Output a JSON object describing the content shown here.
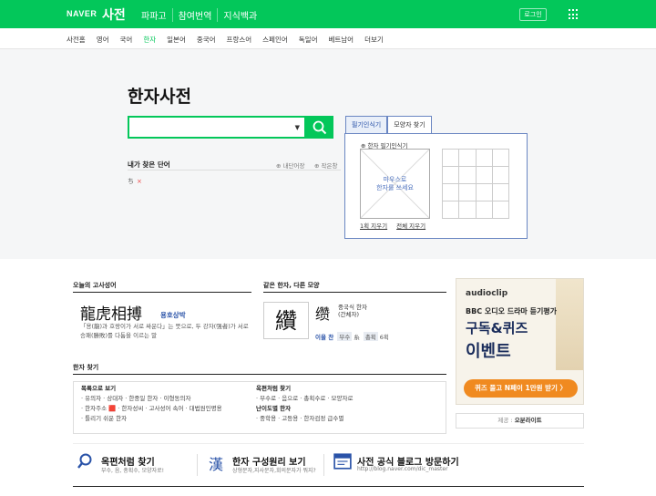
{
  "header": {
    "logo": "NAVER",
    "service": "사전",
    "nav": [
      "파파고",
      "참여번역",
      "지식백과"
    ],
    "login": "로그인"
  },
  "subnav": {
    "items": [
      "사전홈",
      "영어",
      "국어",
      "한자",
      "일본어",
      "중국어",
      "프랑스어",
      "스페인어",
      "독일어",
      "베트남어",
      "더보기"
    ],
    "active_index": 3
  },
  "hero": {
    "title": "한자사전",
    "search_value": "",
    "recent_title": "내가 찾은 단어",
    "recent_opt1": "⊕ 내단어장",
    "recent_opt2": "⊕ 작은창",
    "recent_item": "ち"
  },
  "handwriting": {
    "tab1": "필기인식기",
    "tab2": "모양자 찾기",
    "label": "⊕ 한자 필기인식기",
    "hint_line1": "마우스로",
    "hint_line2": "한자를 쓰세요",
    "undo": "1획 지우기",
    "clear": "전체 지우기"
  },
  "proverb": {
    "section": "오늘의 고사성어",
    "hanja": "龍虎相搏",
    "reading": "용호상박",
    "desc": "「용(龍)과 호랑이가 서로 싸운다」는 뜻으로, 두 강자(强者)가 서로 승패(勝敗)를 다툼을 이르는 말"
  },
  "similar": {
    "section": "같은 한자, 다른 모양",
    "char_big": "纘",
    "char": "缵",
    "tag_line1": "중국식 한자",
    "tag_line2": "(간체자)",
    "reading": "이을 찬",
    "radical_label": "부수",
    "radical": "糸",
    "strokes_label": "총획",
    "strokes": "6획"
  },
  "find": {
    "section": "한자 찾기",
    "col1_head": "목록으로 보기",
    "col1_l1": "· 유의자    · 상대자    · 한중일 한자    · 이형동의자",
    "col1_l2": "· 한자주소 🟥 · 한자성씨 · 고사성어 속어 · 대법원인명용",
    "col1_l3": "· 틀리기 쉬운 한자",
    "col2_head": "옥편처럼 찾기",
    "col2_l1": "· 부수로  · 음으로  · 총획수로  · 모양자로",
    "col2_head2": "난이도별 한자",
    "col2_l2": "· 중학용  · 고등용  · 한자검정 급수별"
  },
  "ad": {
    "brand": "audioclip",
    "line1": "BBC 오디오 드라마 듣기평가",
    "line2": "구독&퀴즈",
    "line3": "이벤트",
    "cta": "퀴즈 풀고 N페이 1만원 받기 〉",
    "footer_prefix": "제공 :",
    "footer_name": "오분라이트"
  },
  "bottom": {
    "b1_icon": "search-icon",
    "b1_title": "옥편처럼 찾기",
    "b1_desc": "부수, 음, 총획수, 모양자로!",
    "b2_icon_char": "漢",
    "b2_title": "한자 구성원리 보기",
    "b2_desc": "상형문자,지사문자,회의문자가 뭐지?",
    "b3_title": "사전 공식 블로그 방문하기",
    "b3_desc": "http://blog.naver.com/dic_master"
  },
  "colors": {
    "brand": "#03c75a",
    "link_blue": "#2a53a8",
    "ad_orange": "#f08a20"
  }
}
